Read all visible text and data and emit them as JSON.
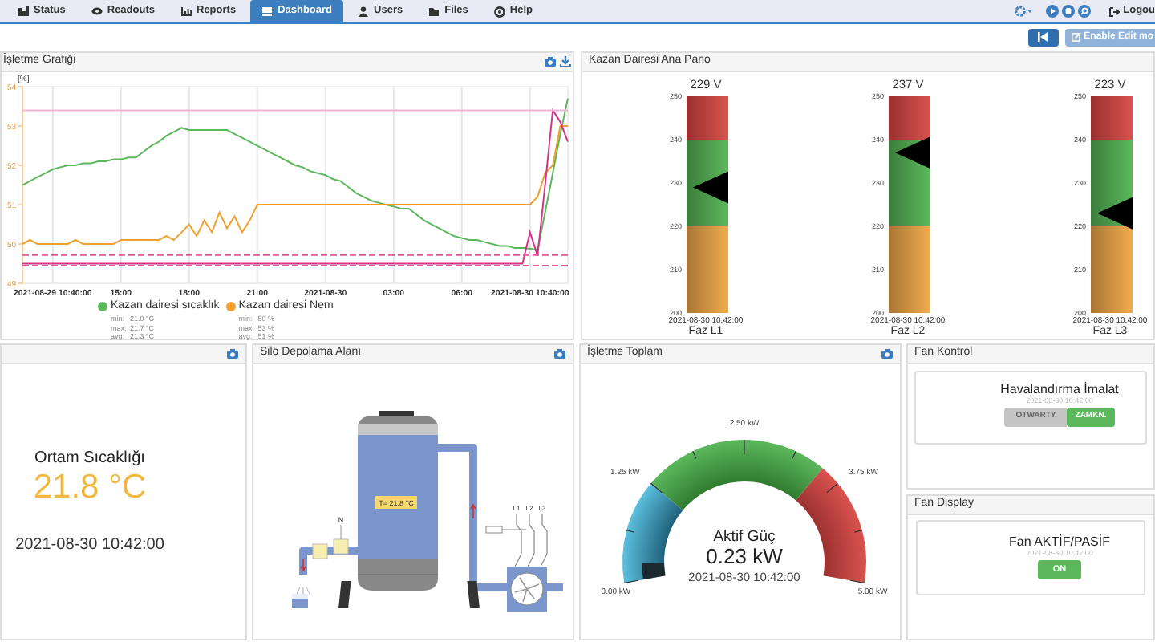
{
  "nav": {
    "tabs": [
      {
        "label": "Status",
        "selected": false
      },
      {
        "label": "Readouts",
        "selected": false
      },
      {
        "label": "Reports",
        "selected": false
      },
      {
        "label": "Dashboard",
        "selected": true
      },
      {
        "label": "Users",
        "selected": false
      },
      {
        "label": "Files",
        "selected": false
      },
      {
        "label": "Help",
        "selected": false
      }
    ],
    "logout": "Logou"
  },
  "toolbar": {
    "edit_button": {
      "label": "Enable Edit mo",
      "disabled": true
    }
  },
  "chart_panel": {
    "title": "İşletme Grafiği",
    "chart_data": {
      "type": "line",
      "ylabel": "[%]",
      "ylim": [
        49,
        54
      ],
      "yticks": [
        49,
        50,
        51,
        52,
        53,
        54
      ],
      "categories": [
        null,
        null,
        null,
        null,
        "2021-08-29 10:40:00",
        null,
        null,
        null,
        null,
        null,
        null,
        null,
        null,
        "15:00",
        null,
        null,
        null,
        null,
        null,
        null,
        null,
        null,
        "18:00",
        null,
        null,
        null,
        null,
        null,
        null,
        null,
        null,
        "21:00",
        null,
        null,
        null,
        null,
        null,
        null,
        null,
        null,
        "2021-08-30",
        null,
        null,
        null,
        null,
        null,
        null,
        null,
        null,
        "03:00",
        null,
        null,
        null,
        null,
        null,
        null,
        null,
        null,
        "06:00",
        null,
        null,
        null,
        null,
        null,
        null,
        null,
        null,
        "2021-08-30 10:40:00",
        null,
        null,
        null,
        null,
        null
      ],
      "grid": true,
      "series": [
        {
          "name": "Kazan dairesi sıcaklık",
          "color": "#5cb85c",
          "values": [
            51.5,
            51.6,
            51.7,
            51.8,
            51.9,
            51.95,
            52.0,
            52.0,
            52.05,
            52.05,
            52.1,
            52.1,
            52.15,
            52.15,
            52.2,
            52.2,
            52.35,
            52.5,
            52.6,
            52.75,
            52.85,
            52.95,
            52.9,
            52.9,
            52.9,
            52.9,
            52.9,
            52.9,
            52.8,
            52.7,
            52.6,
            52.5,
            52.4,
            52.3,
            52.2,
            52.1,
            52.0,
            51.95,
            51.85,
            51.8,
            51.75,
            51.65,
            51.6,
            51.45,
            51.3,
            51.2,
            51.1,
            51.05,
            51.0,
            50.95,
            50.9,
            50.9,
            50.75,
            50.6,
            50.5,
            50.4,
            50.3,
            50.2,
            50.15,
            50.1,
            50.1,
            50.05,
            50.0,
            49.95,
            49.95,
            49.9,
            49.9,
            49.88,
            49.85,
            50.8,
            51.8,
            52.8,
            53.7
          ]
        },
        {
          "name": "Kazan dairesi Nem",
          "color": "#f0a030",
          "values": [
            50,
            50.1,
            50,
            50,
            50,
            50,
            50,
            50.1,
            50,
            50,
            50,
            50,
            50,
            50.1,
            50.1,
            50.1,
            50.1,
            50.1,
            50.1,
            50.2,
            50.1,
            50.3,
            50.5,
            50.2,
            50.6,
            50.3,
            50.8,
            50.4,
            50.7,
            50.3,
            50.6,
            51,
            51,
            51,
            51,
            51,
            51,
            51,
            51,
            51,
            51,
            51,
            51,
            51,
            51,
            51,
            51,
            51,
            51,
            51,
            51,
            51,
            51,
            51,
            51,
            51,
            51,
            51,
            51,
            51,
            51,
            51,
            51,
            51,
            51,
            51,
            51,
            51,
            51.2,
            51.8,
            52,
            53,
            53
          ]
        },
        {
          "color": "#d6338a",
          "values": [
            49.5,
            49.5,
            49.5,
            49.5,
            49.5,
            49.5,
            49.5,
            49.5,
            49.5,
            49.5,
            49.5,
            49.5,
            49.5,
            49.5,
            49.5,
            49.5,
            49.5,
            49.5,
            49.5,
            49.5,
            49.5,
            49.5,
            49.5,
            49.5,
            49.5,
            49.5,
            49.5,
            49.5,
            49.5,
            49.5,
            49.5,
            49.5,
            49.5,
            49.5,
            49.5,
            49.5,
            49.5,
            49.5,
            49.5,
            49.5,
            49.5,
            49.5,
            49.5,
            49.5,
            49.5,
            49.5,
            49.5,
            49.5,
            49.5,
            49.5,
            49.5,
            49.5,
            49.5,
            49.5,
            49.5,
            49.5,
            49.5,
            49.5,
            49.5,
            49.5,
            49.5,
            49.5,
            49.5,
            49.5,
            49.5,
            49.5,
            49.5,
            50.3,
            49.7,
            51.5,
            53.4,
            53.1,
            52.6
          ]
        },
        {
          "color": "#f4b6d6",
          "values": [
            53.4,
            53.4,
            53.4,
            53.4,
            53.4,
            53.4,
            53.4,
            53.4,
            53.4,
            53.4,
            53.4,
            53.4,
            53.4,
            53.4,
            53.4,
            53.4,
            53.4,
            53.4,
            53.4,
            53.4,
            53.4,
            53.4,
            53.4,
            53.4,
            53.4,
            53.4,
            53.4,
            53.4,
            53.4,
            53.4,
            53.4,
            53.4,
            53.4,
            53.4,
            53.4,
            53.4,
            53.4,
            53.4,
            53.4,
            53.4,
            53.4,
            53.4,
            53.4,
            53.4,
            53.4,
            53.4,
            53.4,
            53.4,
            53.4,
            53.4,
            53.4,
            53.4,
            53.4,
            53.4,
            53.4,
            53.4,
            53.4,
            53.4,
            53.4,
            53.4,
            53.4,
            53.4,
            53.4,
            53.4,
            53.4,
            53.4,
            53.4,
            53.4,
            53.4,
            53.4,
            53.4,
            53.4,
            53.4
          ]
        },
        {
          "color": "#e0559a",
          "line_style": "dashed",
          "values": [
            49.72,
            49.72,
            49.72,
            49.72,
            49.72,
            49.72,
            49.72,
            49.72,
            49.72,
            49.72,
            49.72,
            49.72,
            49.72,
            49.72,
            49.72,
            49.72,
            49.72,
            49.72,
            49.72,
            49.72,
            49.72,
            49.72,
            49.72,
            49.72,
            49.72,
            49.72,
            49.72,
            49.72,
            49.72,
            49.72,
            49.72,
            49.72,
            49.72,
            49.72,
            49.72,
            49.72,
            49.72,
            49.72,
            49.72,
            49.72,
            49.72,
            49.72,
            49.72,
            49.72,
            49.72,
            49.72,
            49.72,
            49.72,
            49.72,
            49.72,
            49.72,
            49.72,
            49.72,
            49.72,
            49.72,
            49.72,
            49.72,
            49.72,
            49.72,
            49.72,
            49.72,
            49.72,
            49.72,
            49.72,
            49.72,
            49.72,
            49.72,
            49.72,
            49.72,
            49.72,
            49.72,
            49.72,
            49.72
          ]
        },
        {
          "color": "#e0559a",
          "line_style": "dashed",
          "values": [
            49.45,
            49.45,
            49.45,
            49.45,
            49.45,
            49.45,
            49.45,
            49.45,
            49.45,
            49.45,
            49.45,
            49.45,
            49.45,
            49.45,
            49.45,
            49.45,
            49.45,
            49.45,
            49.45,
            49.45,
            49.45,
            49.45,
            49.45,
            49.45,
            49.45,
            49.45,
            49.45,
            49.45,
            49.45,
            49.45,
            49.45,
            49.45,
            49.45,
            49.45,
            49.45,
            49.45,
            49.45,
            49.45,
            49.45,
            49.45,
            49.45,
            49.45,
            49.45,
            49.45,
            49.45,
            49.45,
            49.45,
            49.45,
            49.45,
            49.45,
            49.45,
            49.45,
            49.45,
            49.45,
            49.45,
            49.45,
            49.45,
            49.45,
            49.45,
            49.45,
            49.45,
            49.45,
            49.45,
            49.45,
            49.45,
            49.45,
            49.45,
            49.45,
            49.45,
            49.45,
            49.45,
            49.45,
            49.45
          ]
        }
      ]
    },
    "legend_stats": [
      [
        {
          "label": "min:",
          "value": "21.0 °C"
        },
        {
          "label": "max:",
          "value": "21.7 °C"
        },
        {
          "label": "avg:",
          "value": "21.3 °C"
        }
      ],
      [
        {
          "label": "min:",
          "value": "50 %"
        },
        {
          "label": "max:",
          "value": "53 %"
        },
        {
          "label": "avg:",
          "value": "51 %"
        }
      ]
    ]
  },
  "voltage_panel": {
    "title": "Kazan Dairesi Ana Pano",
    "meters": [
      {
        "reading": "229 V",
        "level": 0.58,
        "ticks": [
          "250",
          "240",
          "230",
          "220",
          "210",
          "200"
        ],
        "time": "2021-08-30 10:42:00",
        "label": "Faz L1"
      },
      {
        "reading": "237 V",
        "level": 0.74,
        "ticks": [
          "250",
          "240",
          "230",
          "220",
          "210",
          "200"
        ],
        "time": "2021-08-30 10:42:00",
        "label": "Faz L2"
      },
      {
        "reading": "223 V",
        "level": 0.46,
        "ticks": [
          "250",
          "240",
          "230",
          "220",
          "210",
          "200"
        ],
        "time": "2021-08-30 10:42:00",
        "label": "Faz L3"
      }
    ]
  },
  "temperature_panel": {
    "label": "Ortam Sıcaklığı",
    "value": "21.8 °C",
    "time": "2021-08-30 10:42:00"
  },
  "silo_panel": {
    "title": "Silo Depolama Alanı",
    "tank_label": "T= 21.8 °C",
    "valve_label": "N",
    "phase_labels": [
      "L1",
      "L2",
      "L3"
    ]
  },
  "power_panel": {
    "title": "İşletme Toplam",
    "label": "Aktif Güç",
    "value": "0.23 kW",
    "level": 0.046,
    "time": "2021-08-30 10:42:00",
    "ticks": [
      "0.00 kW",
      "1.25 kW",
      "2.50 kW",
      "3.75 kW",
      "5.00 kW"
    ]
  },
  "fan_control": {
    "title": "Fan Kontrol",
    "name": "Havalandırma İmalat",
    "time": "2021-08-30 10:42:00",
    "options": [
      {
        "label": "OTWARTY",
        "selected": false
      },
      {
        "label": "ZAMKN.",
        "selected": true
      }
    ]
  },
  "fan_display": {
    "title": "Fan Display",
    "name": "Fan AKTİF/PASİF",
    "time": "2021-08-30 10:42:00",
    "state": {
      "label": "ON",
      "on": true
    }
  }
}
